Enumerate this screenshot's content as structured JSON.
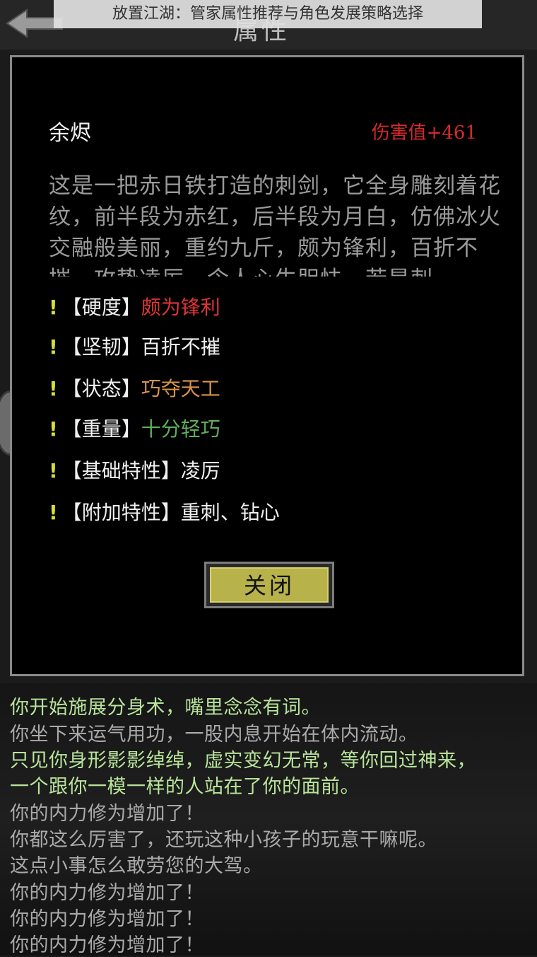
{
  "caption": "放置江湖：管家属性推荐与角色发展策略选择",
  "screen_title": "属性",
  "item": {
    "name": "余烬",
    "damage": "伤害值+461",
    "description": "这是一把赤日铁打造的刺剑，它全身雕刻着花纹，前半段为赤红，后半段为月白，仿佛冰火交融般美丽，重约九斤，颇为锋利，百折不摧，攻势凌厉，令人心生胆怯，若是刺"
  },
  "attributes": [
    {
      "bang": "!",
      "key": "【硬度】",
      "value": "颇为锋利",
      "color": "#e03434"
    },
    {
      "bang": "!",
      "key": "【坚韧】",
      "value": "百折不摧",
      "color": "#f0f0f0"
    },
    {
      "bang": "!",
      "key": "【状态】",
      "value": "巧夺天工",
      "color": "#d89448"
    },
    {
      "bang": "!",
      "key": "【重量】",
      "value": "十分轻巧",
      "color": "#5fb05a"
    },
    {
      "bang": "!",
      "key": "【基础特性】",
      "value": "凌厉",
      "color": "#f0f0f0"
    },
    {
      "bang": "!",
      "key": "【附加特性】",
      "value": "重刺、钻心",
      "color": "#f0f0f0"
    }
  ],
  "close_label": "关闭",
  "log": [
    {
      "text": "你开始施展分身术，嘴里念念有词。",
      "color": "#b9e59a"
    },
    {
      "text": "你坐下来运气用功，一股内息开始在体内流动。",
      "color": "#aaaaaa"
    },
    {
      "text": "只见你身形影影绰绰，虚实变幻无常，等你回过神来，",
      "color": "#b9e59a"
    },
    {
      "text": "一个跟你一模一样的人站在了你的面前。",
      "color": "#b9e59a"
    },
    {
      "text": "你的内力修为增加了！",
      "color": "#aaaaaa"
    },
    {
      "text": "你都这么厉害了，还玩这种小孩子的玩意干嘛呢。",
      "color": "#aaaaaa"
    },
    {
      "text": "这点小事怎么敢劳您的大驾。",
      "color": "#aaaaaa"
    },
    {
      "text": "你的内力修为增加了！",
      "color": "#aaaaaa"
    },
    {
      "text": "你的内力修为增加了！",
      "color": "#aaaaaa"
    },
    {
      "text": "你的内力修为增加了！",
      "color": "#aaaaaa"
    }
  ]
}
